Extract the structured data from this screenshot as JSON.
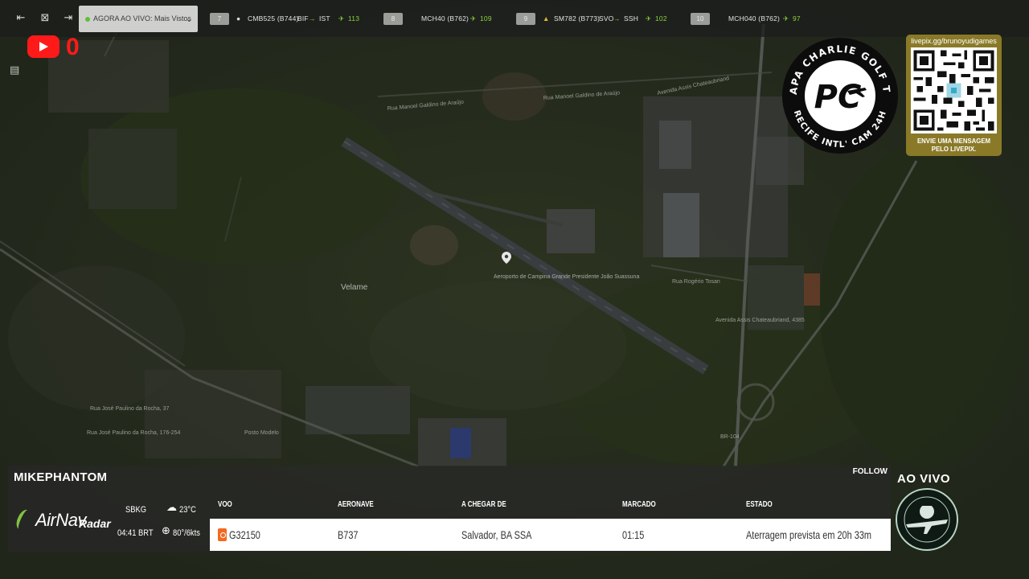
{
  "topbar": {
    "live_label": "AGORA AO VIVO: Mais Vistos",
    "slots": [
      {
        "num": "7",
        "callsign": "CMB525 (B744)",
        "from": "BIF",
        "to": "IST",
        "alt": "113"
      },
      {
        "num": "8",
        "callsign": "MCH40 (B762)",
        "alt": "109"
      },
      {
        "num": "9",
        "callsign": "SM782 (B773)",
        "from": "SVO",
        "to": "SSH",
        "alt": "102"
      },
      {
        "num": "10",
        "callsign": "MCH040 (B762)",
        "alt": "97"
      }
    ]
  },
  "youtube": {
    "count": "0"
  },
  "map_labels": [
    "Rua Manoel Galdino de Araújo",
    "Rua Manoel Galdino de Araújo",
    "Avenida Assis Chateaubriand",
    "Velame",
    "Aeroporto de Campina Grande Presidente João Suassuna",
    "Rua Rogério Tosan",
    "Avenida Assis Chateaubriand, 4385",
    "Rua José Paulino da Rocha, 37",
    "Rua José Paulino da Rocha, 176-254",
    "Posto Modelo",
    "BR-104"
  ],
  "logo": {
    "top_text": "PAPA CHARLIE GOLF TV",
    "bottom_text": "RECIFE INTL' CAM 24H",
    "mark": "PC"
  },
  "qr": {
    "url": "livepix.gg/brunoyudigames",
    "message_line1": "ENVIE UMA MENSAGEM",
    "message_line2": "PELO LIVEPIX."
  },
  "panel": {
    "username": "MIKEPHANTOM",
    "follow": "FOLLOW",
    "brand_air": "AirNav",
    "brand_radar": "Radar",
    "airport": "SBKG",
    "temp": "23°C",
    "time": "04:41 BRT",
    "wind": "80°/6kts",
    "headers": {
      "voo": "VOO",
      "aeronave": "AERONAVE",
      "a_chegar_de": "A CHEGAR DE",
      "marcado": "MARCADO",
      "estado": "ESTADO"
    },
    "flight": {
      "voo": "G32150",
      "aeronave": "B737",
      "a_chegar_de": "Salvador, BA SSA",
      "marcado": "01:15",
      "estado": "Aterragem prevista em 20h 33m"
    }
  },
  "ao_vivo": "AO VIVO",
  "colors": {
    "youtube": "#ff1a1a",
    "airnav_green": "#82c341",
    "gol_orange": "#f26a21",
    "qr_gold": "#8a7a28",
    "alt_green": "#8cd23c"
  }
}
